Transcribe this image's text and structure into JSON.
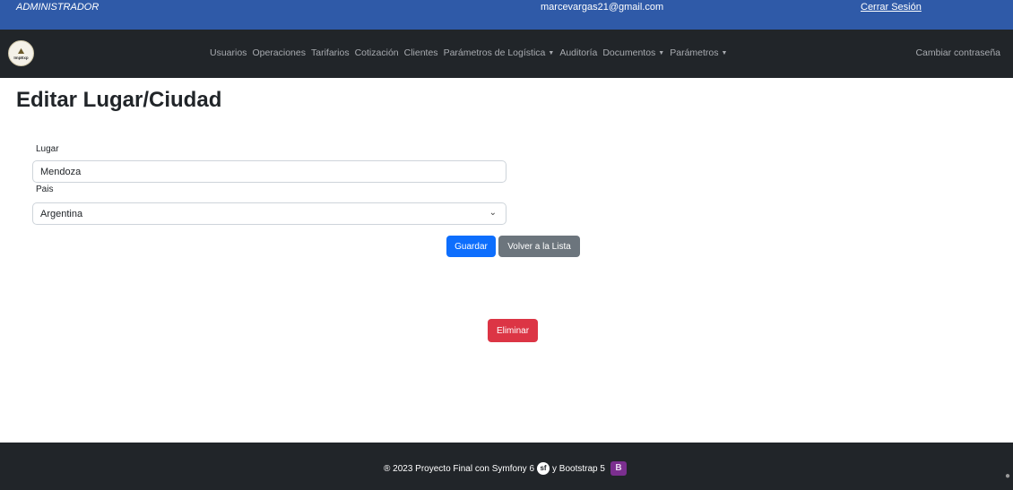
{
  "topbar": {
    "role": "ADMINISTRADOR",
    "email": "marcevargas21@gmail.com",
    "logout": "Cerrar Sesión"
  },
  "navbar": {
    "logo_text": "ImpExp",
    "items": [
      {
        "label": "Usuarios",
        "dropdown": false
      },
      {
        "label": "Operaciones",
        "dropdown": false
      },
      {
        "label": "Tarifarios",
        "dropdown": false
      },
      {
        "label": "Cotización",
        "dropdown": false
      },
      {
        "label": "Clientes",
        "dropdown": false
      },
      {
        "label": "Parámetros de Logística",
        "dropdown": true
      },
      {
        "label": "Auditoría",
        "dropdown": false
      },
      {
        "label": "Documentos",
        "dropdown": true
      },
      {
        "label": "Parámetros",
        "dropdown": true
      }
    ],
    "change_password": "Cambiar contraseña"
  },
  "page": {
    "title": "Editar Lugar/Ciudad"
  },
  "form": {
    "lugar_label": "Lugar",
    "lugar_value": "Mendoza",
    "pais_label": "Pais",
    "pais_value": "Argentina"
  },
  "buttons": {
    "save": "Guardar",
    "back": "Volver a la Lista",
    "delete": "Eliminar"
  },
  "footer": {
    "text_left": "® 2023 Proyecto Final con Symfony 6",
    "text_mid": "y Bootstrap 5"
  },
  "colors": {
    "topbar": "#2f5aa8",
    "navbar": "#212529",
    "primary": "#0d6efd",
    "secondary": "#6c757d",
    "danger": "#dc3545"
  }
}
